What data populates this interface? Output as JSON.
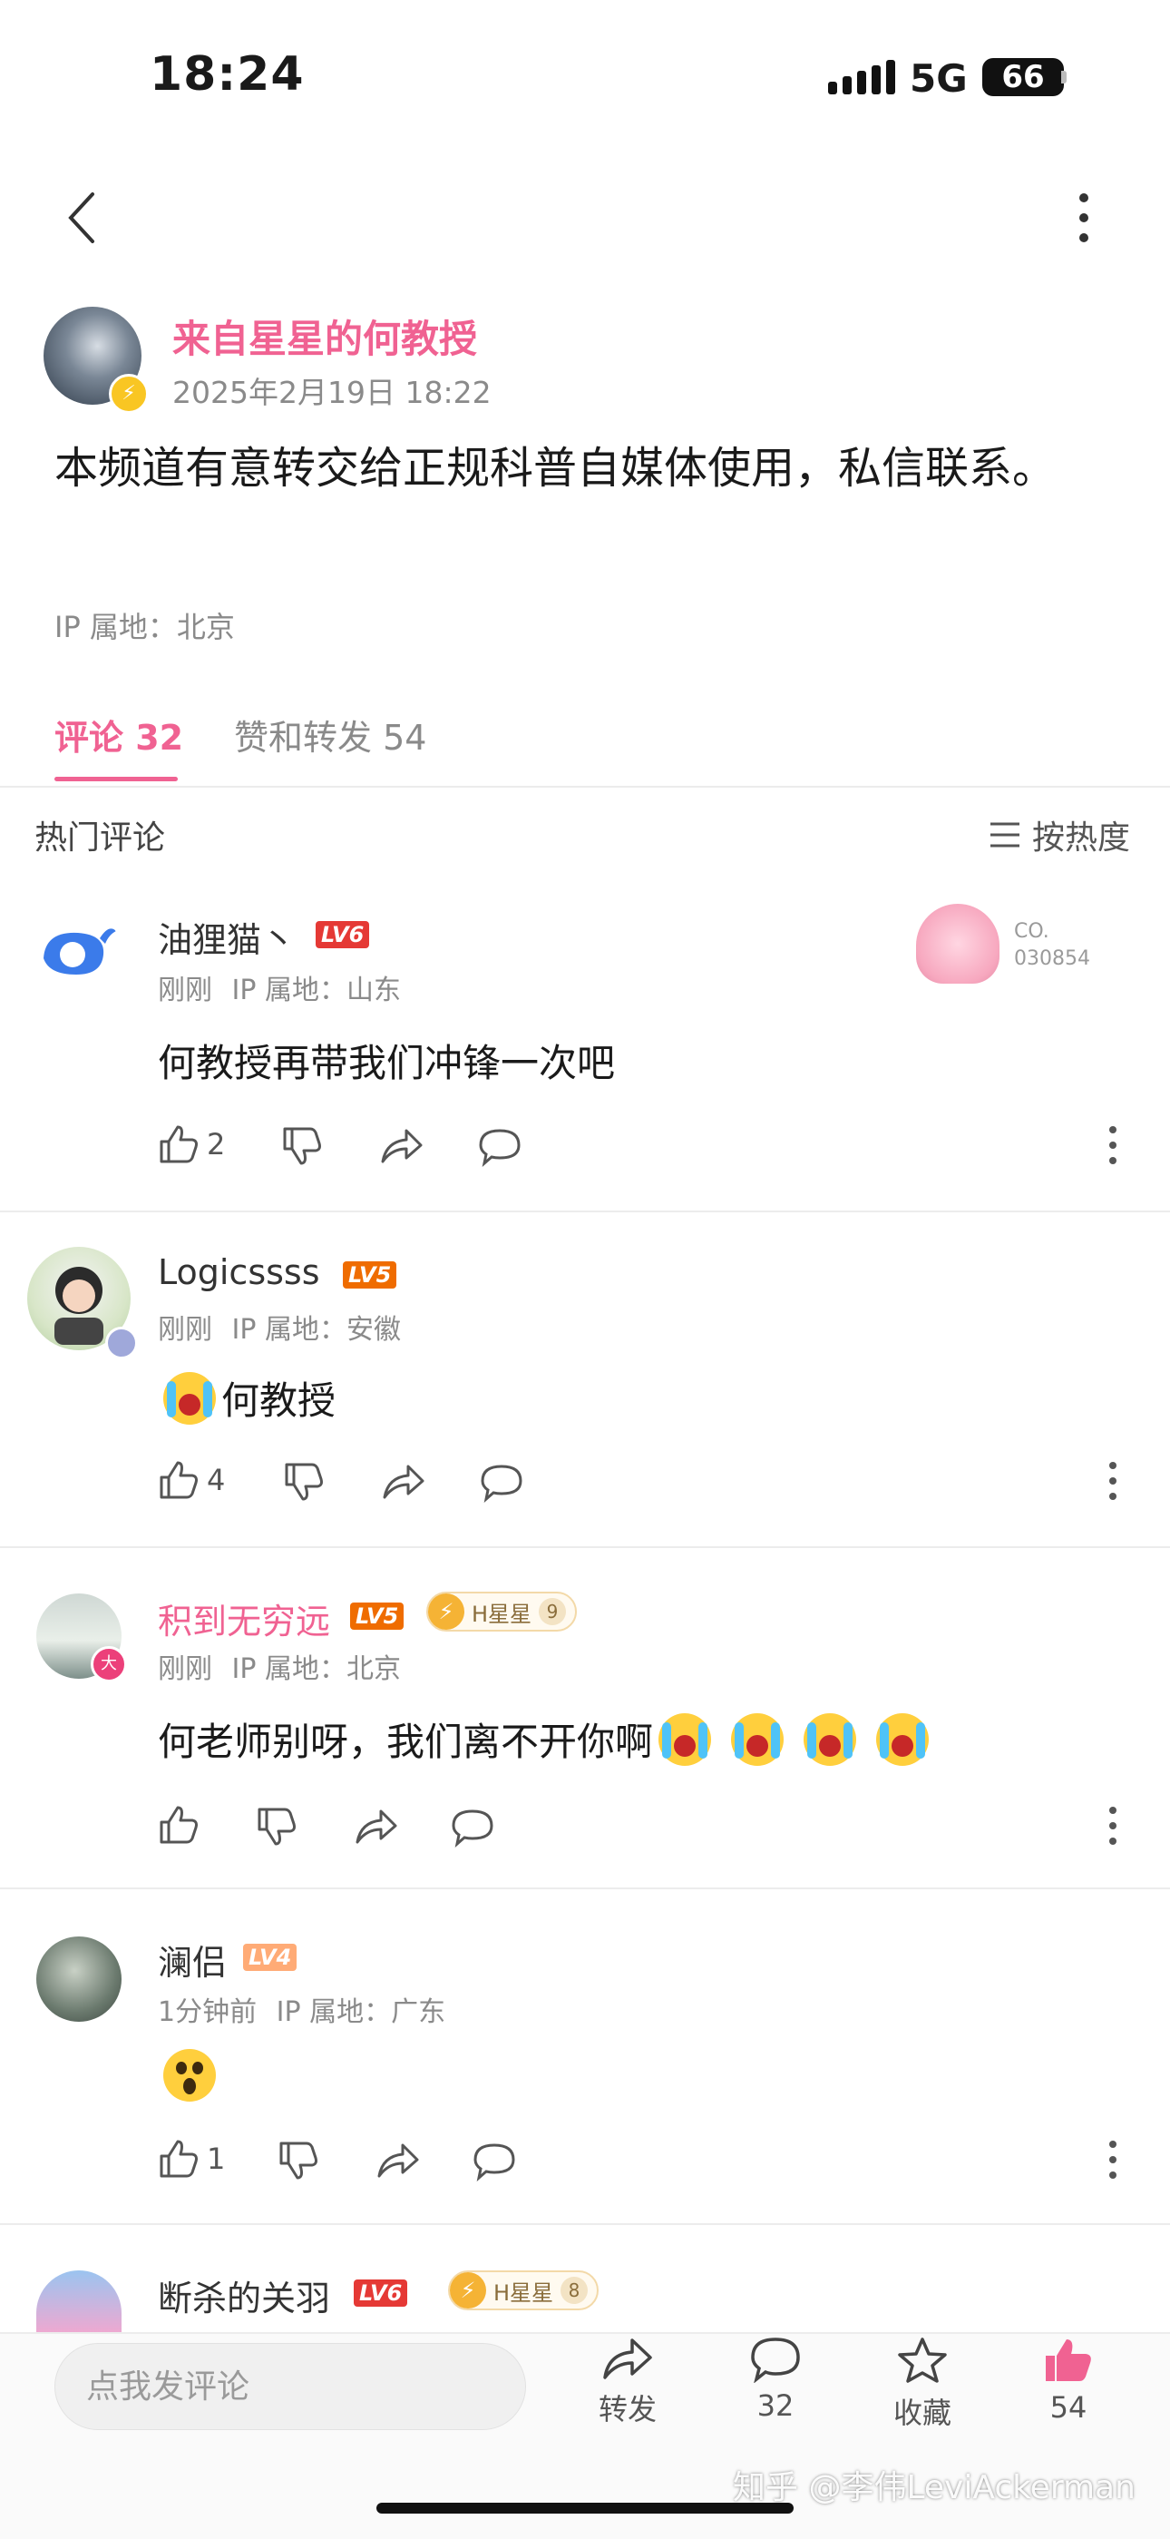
{
  "status_bar": {
    "time": "18:24",
    "network": "5G",
    "battery": "66"
  },
  "post": {
    "author": "来自星星的何教授",
    "date": "2025年2月19日 18:22",
    "text": "本频道有意转交给正规科普自媒体使用，私信联系。",
    "ip": "IP 属地：北京"
  },
  "tabs": {
    "comments": "评论 32",
    "likes_reposts": "赞和转发 54"
  },
  "comments_section": {
    "title": "热门评论",
    "sort_label": "按热度"
  },
  "comments": [
    {
      "name": "油狸猫丶",
      "level": "LV6",
      "time": "刚刚",
      "ip": "IP 属地：山东",
      "text": "何教授再带我们冲锋一次吧",
      "likes": "2",
      "badge_text_1": "CO.",
      "badge_text_2": "030854"
    },
    {
      "name": "Logicssss",
      "level": "LV5",
      "time": "刚刚",
      "ip": "IP 属地：安徽",
      "text": "何教授",
      "likes": "4"
    },
    {
      "name": "积到无穷远",
      "level": "LV5",
      "time": "刚刚",
      "ip": "IP 属地：北京",
      "text": "何老师别呀，我们离不开你啊",
      "likes": "",
      "hstar_label": "H星星",
      "hstar_count": "9"
    },
    {
      "name": "澜侣",
      "level": "LV4",
      "time": "1分钟前",
      "ip": "IP 属地：广东",
      "text": "",
      "likes": "1"
    },
    {
      "name": "断杀的关羽",
      "level": "LV6",
      "hstar_label": "H星星",
      "hstar_count": "8"
    }
  ],
  "bottom_bar": {
    "input_placeholder": "点我发评论",
    "repost_label": "转发",
    "comment_count": "32",
    "favorite_label": "收藏",
    "like_count": "54"
  },
  "watermark": "知乎 @李伟LeviAckerman",
  "colors": {
    "accent": "#f06292",
    "lv6": "#e53935",
    "lv5": "#ef6c00",
    "lv4": "#ffab76"
  }
}
